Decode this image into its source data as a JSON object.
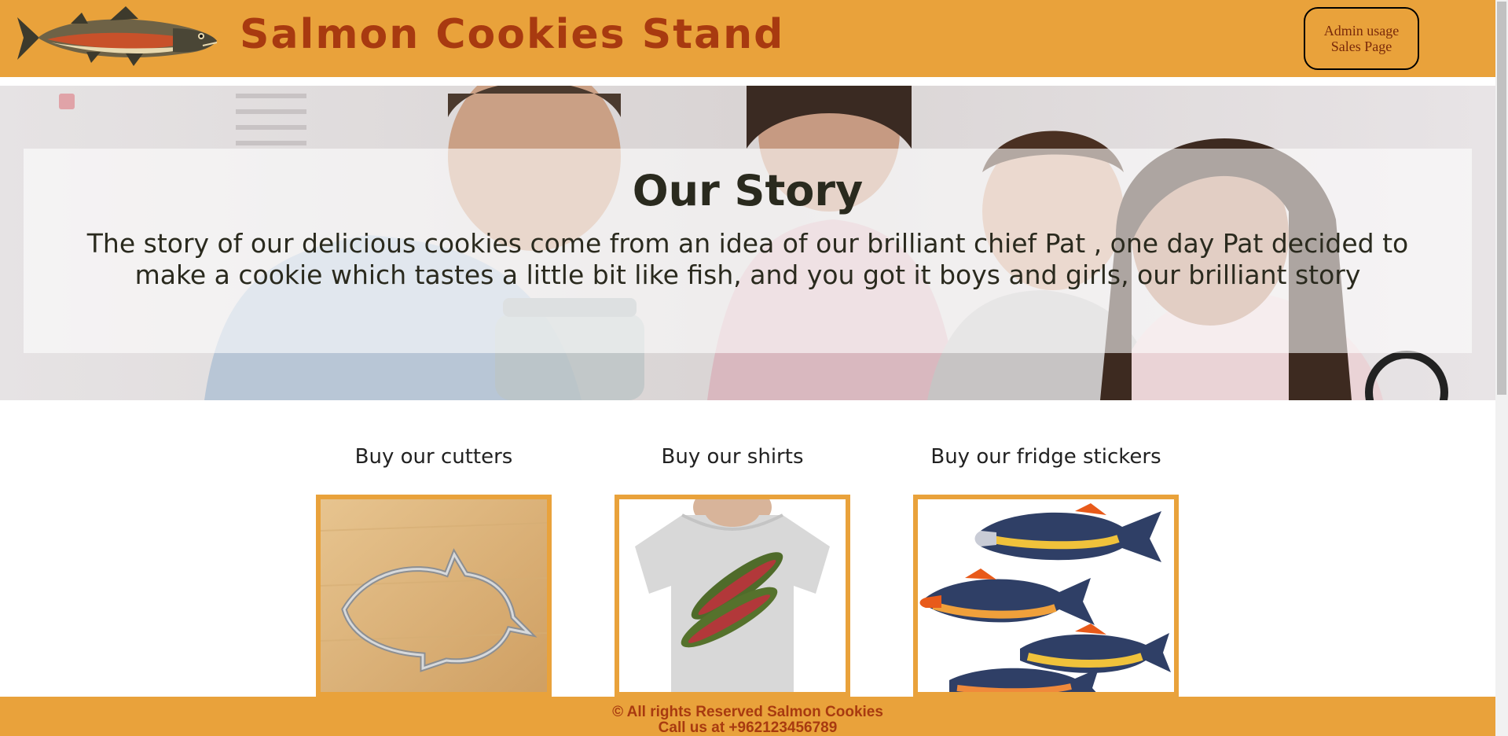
{
  "header": {
    "site_title": "Salmon Cookies Stand",
    "logo_icon": "salmon-fish-icon",
    "admin_button": {
      "line1": "Admin usage",
      "line2": "Sales Page"
    }
  },
  "hero": {
    "title": "Our Story",
    "text": "The story of our delicious cookies come from an idea of our brilliant chief Pat , one day Pat decided to make a cookie which tastes a little bit like fish, and you got it boys and girls, our brilliant story"
  },
  "products": [
    {
      "title": "Buy our cutters",
      "image": "salmon-cookie-cutter-image"
    },
    {
      "title": "Buy our shirts",
      "image": "salmon-tshirt-image"
    },
    {
      "title": "Buy our fridge stickers",
      "image": "salmon-fridge-stickers-image"
    }
  ],
  "footer": {
    "line1": "© All rights Reserved Salmon Cookies",
    "line2": "Call us at +962123456789"
  },
  "colors": {
    "brand_orange": "#e9a23b",
    "title_rust": "#a83a10",
    "text_dark": "#2a2a1e"
  }
}
